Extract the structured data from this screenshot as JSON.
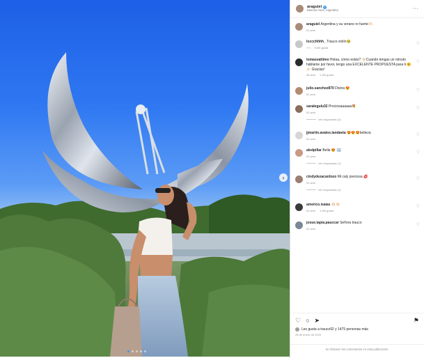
{
  "post": {
    "author": "araguiel",
    "location": "Buenos Aires, Argentina",
    "verified_icon": "verified-badge-icon",
    "more_icon": "more-options-icon"
  },
  "comments": [
    {
      "user": "araguiel",
      "text": "Argentina y su verano re fuerte🫶🏻",
      "time": "51 sem",
      "likes": "",
      "replies": ""
    },
    {
      "user": "loccchhhh_",
      "text": "Trauco violín🥹",
      "time": "7 h",
      "likes": "6 Me gusta",
      "replies": ""
    },
    {
      "user": "tomasvattimo",
      "text": "Holaa, cómo estás? 👋🏻Cuando tengas un minuto háblame por favor, tengo una EXCELENTE PROPUESTA para ti 🤗👉🏻 Gracias!",
      "time": "46 sem",
      "likes": "1 Me gusta",
      "replies": ""
    },
    {
      "user": "julio.sanchez870",
      "text": "Divina 😍",
      "time": "51 sem",
      "likes": "",
      "replies": ""
    },
    {
      "user": "saralegulu32",
      "text": "Preciosaaaaaa💐",
      "time": "51 sem",
      "likes": "",
      "replies": "Ver respuestas (2)"
    },
    {
      "user": "jjmartin.avalos.landaeta",
      "text": "😍😍😍belleza",
      "time": "51 sem",
      "likes": "",
      "replies": ""
    },
    {
      "user": "aledpillar",
      "text": "Bella 😍 🇦🇷",
      "time": "51 sem",
      "likes": "",
      "replies": "Ver respuestas (1)"
    },
    {
      "user": "cindydezacardozo",
      "text": "Mi caly preciosa 💋",
      "time": "51 sem",
      "likes": "",
      "replies": "Ver respuestas (1)"
    },
    {
      "user": "americo.isaias",
      "text": "👏🏻👏🏻",
      "time": "51 sem",
      "likes": "1 Me gusta",
      "replies": ""
    },
    {
      "user": "josue.tapia.pauccar",
      "text": "Señora trauco",
      "time": "51 sem",
      "likes": "",
      "replies": ""
    }
  ],
  "actions": {
    "like_icon": "heart-icon",
    "comment_icon": "comment-icon",
    "share_icon": "share-icon",
    "save_icon": "bookmark-icon",
    "likes_text": "Les gusta a trauco92 y 1475 personas más",
    "date": "26 de enero de 2025"
  },
  "footer": "Se limitaron los comentarios en esta publicación.",
  "colors": {
    "accent": "#3797f0",
    "muted": "#8e8e8e",
    "text": "#262626"
  }
}
